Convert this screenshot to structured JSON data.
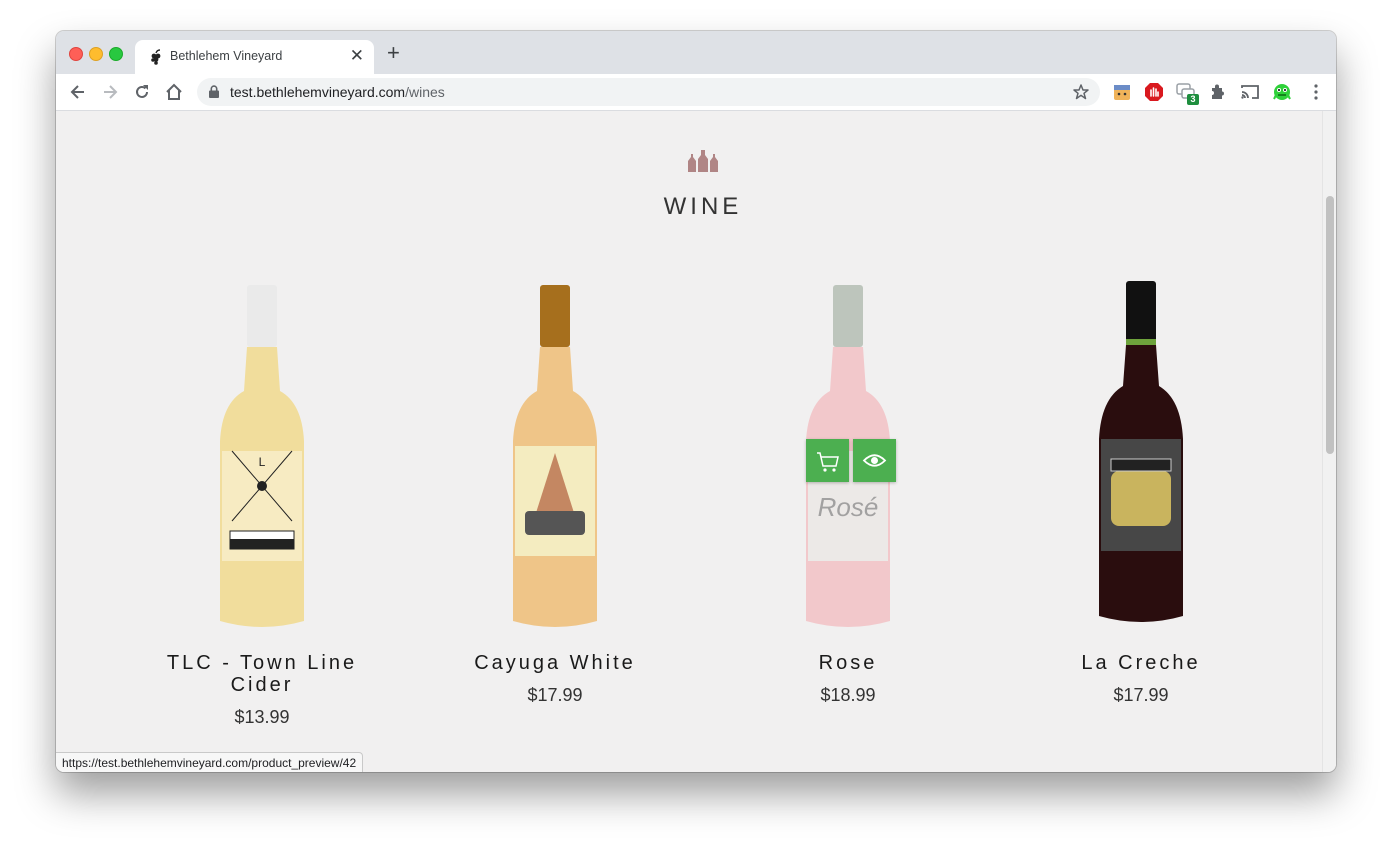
{
  "browser": {
    "tab_title": "Bethlehem Vineyard",
    "url_host": "test.bethlehemvineyard.com",
    "url_path": "/wines",
    "extension_badge": "3",
    "status_url": "https://test.bethlehemvineyard.com/product_preview/42"
  },
  "page": {
    "section_title": "WINE",
    "products": [
      {
        "name": "TLC - Town Line Cider",
        "price": "$13.99",
        "wine_color": "#f1dd9c",
        "label_color": "#ffffff"
      },
      {
        "name": "Cayuga White",
        "price": "$17.99",
        "wine_color": "#efc588",
        "label_color": "#f4ecc0"
      },
      {
        "name": "Rose",
        "price": "$18.99",
        "wine_color": "#f3c2c4",
        "label_color": "#e9e3df"
      },
      {
        "name": "La Creche",
        "price": "$17.99",
        "wine_color": "#2a0d0e",
        "label_color": "#474747"
      }
    ],
    "hover_actions": {
      "add_to_cart": "cart-icon",
      "quick_view": "eye-icon"
    }
  },
  "colors": {
    "accent_green": "#4caf50",
    "icon_mauve": "#b08585"
  }
}
